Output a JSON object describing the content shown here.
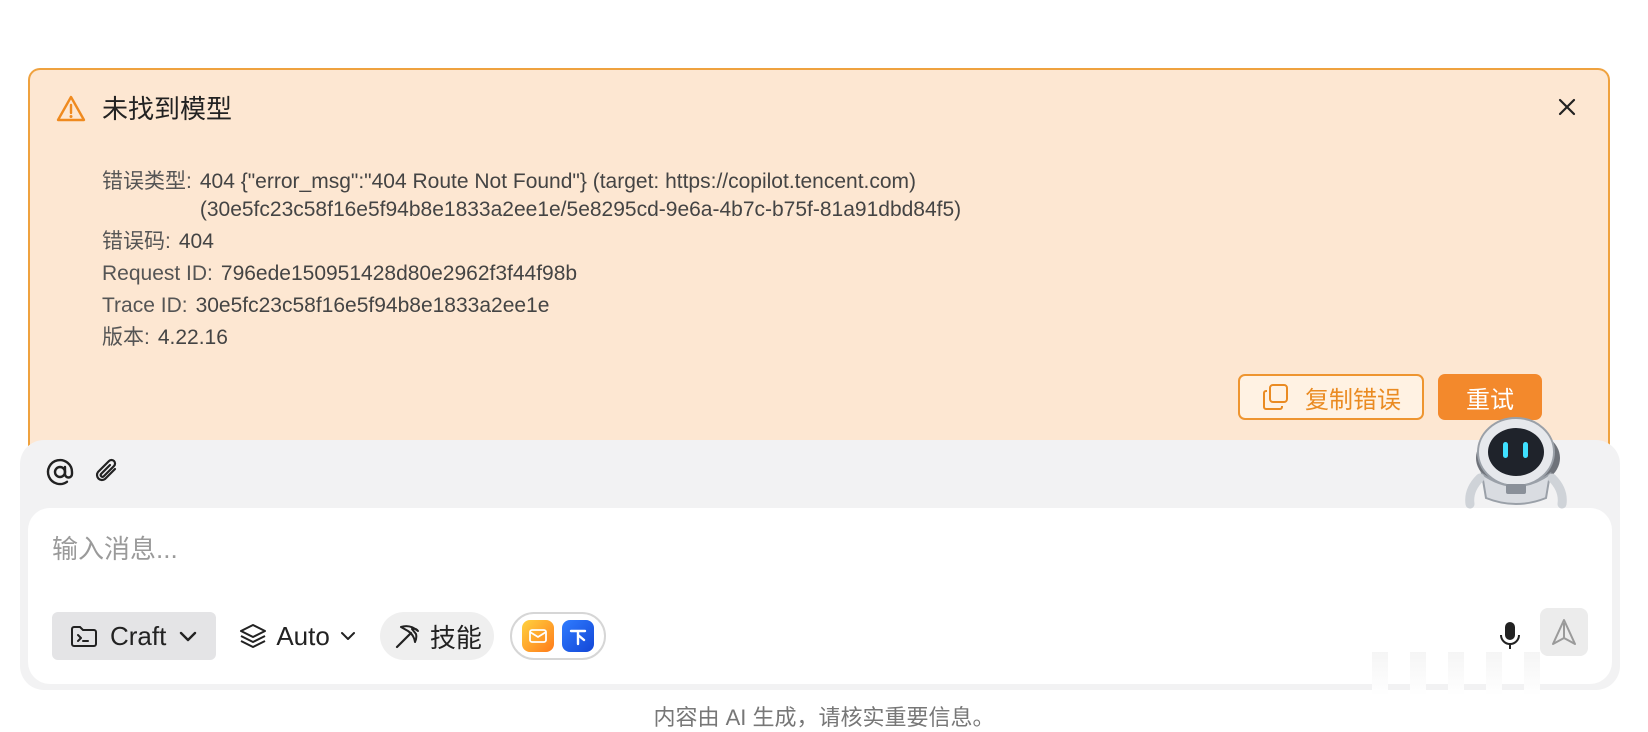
{
  "error": {
    "title": "未找到模型",
    "fields": [
      {
        "label": "错误类型:",
        "value": "404 {\"error_msg\":\"404 Route Not Found\"} (target: https://copilot.tencent.com)\n(30e5fc23c58f16e5f94b8e1833a2ee1e/5e8295cd-9e6a-4b7c-b75f-81a91dbd84f5)"
      },
      {
        "label": "错误码:",
        "value": "404"
      },
      {
        "label": "Request ID:",
        "value": "796ede150951428d80e2962f3f44f98b"
      },
      {
        "label": "Trace ID:",
        "value": "30e5fc23c58f16e5f94b8e1833a2ee1e"
      },
      {
        "label": "版本:",
        "value": "4.22.16"
      }
    ],
    "copy_label": "复制错误",
    "retry_label": "重试"
  },
  "composer": {
    "placeholder": "输入消息...",
    "mode_label": "Craft",
    "model_label": "Auto",
    "skills_label": "技能"
  },
  "footer": {
    "note": "内容由 AI 生成，请核实重要信息。"
  },
  "colors": {
    "panel_bg": "#fde7d2",
    "panel_border": "#efa23f",
    "accent": "#f3892c"
  },
  "icons": [
    "warning-icon",
    "close-icon",
    "copy-icon",
    "at-icon",
    "paperclip-icon",
    "terminal-folder-icon",
    "chevron-down-icon",
    "layers-icon",
    "pickaxe-icon",
    "mail-app-icon",
    "blue-app-icon",
    "microphone-icon",
    "send-icon",
    "robot-mascot"
  ]
}
